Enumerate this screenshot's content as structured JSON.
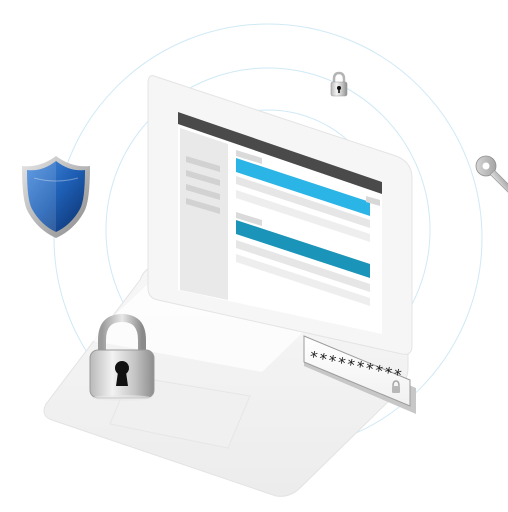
{
  "illustration": {
    "password_field": {
      "value": "**********",
      "lock_icon": "small-lock-icon"
    },
    "icons": {
      "shield": "shield-icon",
      "padlock_large": "padlock-icon",
      "padlock_small": "padlock-small-icon",
      "key": "key-icon"
    },
    "colors": {
      "accent_light": "#2bb5e6",
      "accent_dark": "#1a94b8",
      "shield_blue": "#1e5fb5",
      "screen_header": "#4a4a4a",
      "ring": "#cfe9f6"
    }
  }
}
